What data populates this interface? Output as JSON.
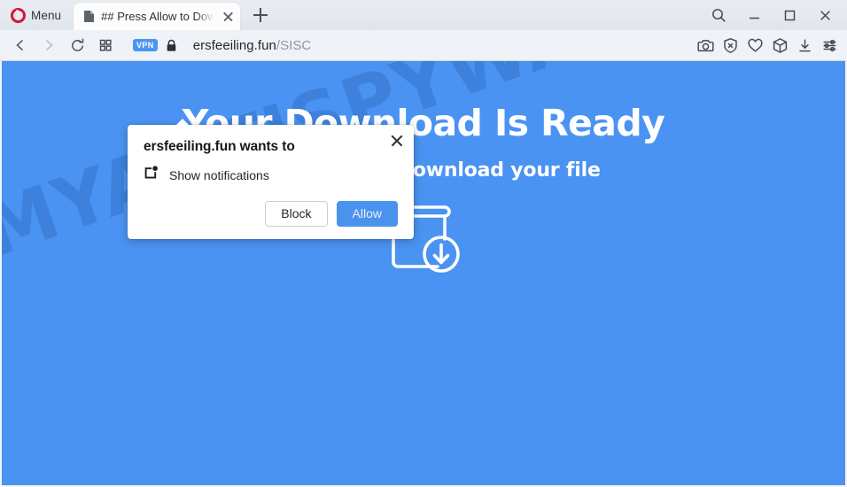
{
  "browser": {
    "name": "Opera",
    "menu_label": "Menu",
    "logo_color": "#d6133d",
    "tab": {
      "title": "## Press Allow to Download Your File",
      "favicon": "page-favicon",
      "close_icon": "close-icon"
    },
    "new_tab_icon": "plus-icon",
    "window_controls": [
      {
        "name": "search-icon",
        "glyph": "search"
      },
      {
        "name": "minimize-icon",
        "glyph": "minimize"
      },
      {
        "name": "maximize-icon",
        "glyph": "maximize"
      },
      {
        "name": "close-window-icon",
        "glyph": "close"
      }
    ],
    "navigation": [
      {
        "name": "back-button",
        "glyph": "chevron-left",
        "enabled": true
      },
      {
        "name": "forward-button",
        "glyph": "chevron-right",
        "enabled": false
      },
      {
        "name": "reload-button",
        "glyph": "reload",
        "enabled": true
      },
      {
        "name": "speed-dial-button",
        "glyph": "grid",
        "enabled": true
      }
    ],
    "address": {
      "vpn_badge": "VPN",
      "vpn_badge_color": "#4a96f2",
      "lock_icon": "lock-icon",
      "domain": "ersfeeiling.fun",
      "path": "/SISC"
    },
    "toolbar_icons": [
      {
        "name": "snapshot-icon",
        "glyph": "camera"
      },
      {
        "name": "ad-blocker-icon",
        "glyph": "shield-x"
      },
      {
        "name": "favorites-icon",
        "glyph": "heart"
      },
      {
        "name": "crypto-wallet-icon",
        "glyph": "cube"
      },
      {
        "name": "downloads-icon",
        "glyph": "download"
      },
      {
        "name": "easy-setup-icon",
        "glyph": "sliders"
      }
    ]
  },
  "page": {
    "background_color": "#4a93f2",
    "heading": "Your Download Is Ready",
    "subheading": "Click Allow to download your file",
    "download_icon": "file-download-icon",
    "watermark": "MYANTISPYWARE.COM"
  },
  "permission_dialog": {
    "title": "ersfeeiling.fun wants to",
    "permission_icon": "notification-icon",
    "permission_label": "Show notifications",
    "close_icon": "close-icon",
    "block_label": "Block",
    "allow_label": "Allow",
    "allow_color": "#4a93ec"
  }
}
